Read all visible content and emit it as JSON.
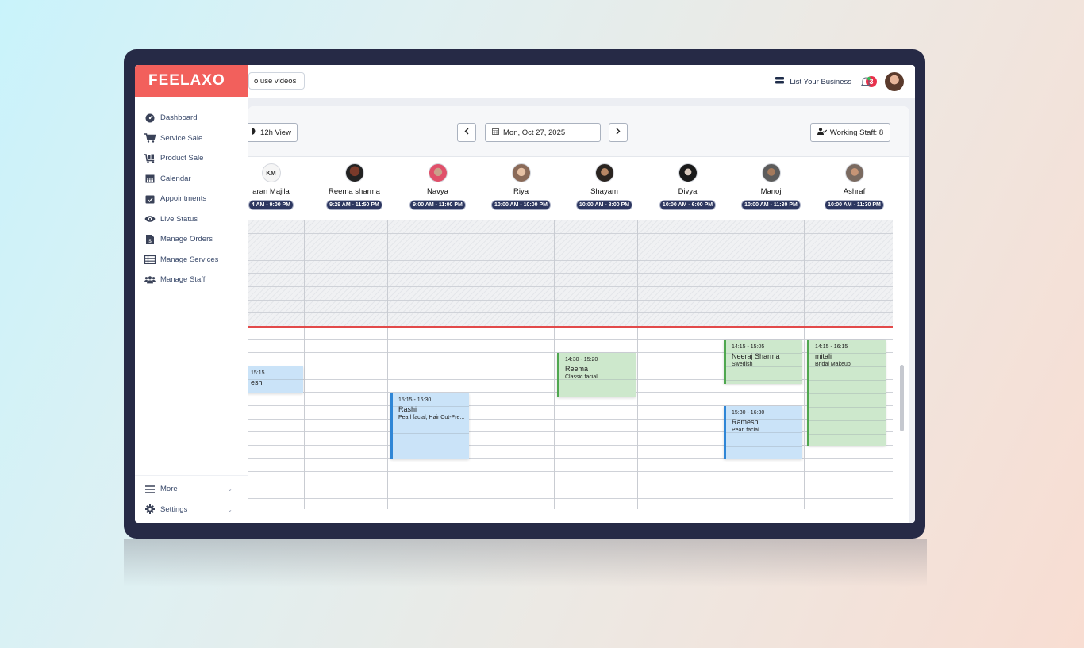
{
  "app": {
    "logo": "FEELAXO"
  },
  "sidebar": {
    "items": [
      {
        "label": "Dashboard",
        "icon": "dashboard-icon"
      },
      {
        "label": "Service Sale",
        "icon": "cart-icon"
      },
      {
        "label": "Product Sale",
        "icon": "cart-loaded-icon"
      },
      {
        "label": "Calendar",
        "icon": "calendar-icon"
      },
      {
        "label": "Appointments",
        "icon": "calendar-check-icon"
      },
      {
        "label": "Live Status",
        "icon": "eye-icon"
      },
      {
        "label": "Manage Orders",
        "icon": "invoice-icon"
      },
      {
        "label": "Manage Services",
        "icon": "table-icon"
      },
      {
        "label": "Manage Staff",
        "icon": "users-icon"
      }
    ],
    "bottom": [
      {
        "label": "More",
        "icon": "menu-icon"
      },
      {
        "label": "Settings",
        "icon": "gear-icon"
      }
    ]
  },
  "topbar": {
    "videos_label": "o use videos",
    "list_business": "List Your Business",
    "notification_count": "3"
  },
  "toolbar": {
    "view_label": "12h View",
    "date_label": "Mon, Oct 27, 2025",
    "working_staff": "Working Staff: 8"
  },
  "staff": [
    {
      "name": "aran Majila",
      "hours": "4 AM - 9:00 PM",
      "initials": "KM"
    },
    {
      "name": "Reema sharma",
      "hours": "9:29 AM - 11:50 PM"
    },
    {
      "name": "Navya",
      "hours": "9:00 AM - 11:00 PM"
    },
    {
      "name": "Riya",
      "hours": "10:00 AM - 10:00 PM"
    },
    {
      "name": "Shayam",
      "hours": "10:00 AM - 8:00 PM"
    },
    {
      "name": "Divya",
      "hours": "10:00 AM - 6:00 PM"
    },
    {
      "name": "Manoj",
      "hours": "10:00 AM - 11:30 PM"
    },
    {
      "name": "Ashraf",
      "hours": "10:00 AM - 11:30 PM"
    }
  ],
  "appointments": [
    {
      "time": "15:15",
      "client": "esh",
      "service": "",
      "color": "blue"
    },
    {
      "time": "15:15 - 16:30",
      "client": "Rashi",
      "service": "Pearl facial, Hair Cut-Pre...",
      "color": "blue"
    },
    {
      "time": "14:30 - 15:20",
      "client": "Reema",
      "service": "Classic facial",
      "color": "green"
    },
    {
      "time": "14:15 - 15:05",
      "client": "Neeraj Sharma",
      "service": "Swedish",
      "color": "green"
    },
    {
      "time": "15:30 - 16:30",
      "client": "Ramesh",
      "service": "Pearl facial",
      "color": "blue"
    },
    {
      "time": "14:15 - 16:15",
      "client": "mitali",
      "service": "Bridal Makeup",
      "color": "green"
    }
  ]
}
